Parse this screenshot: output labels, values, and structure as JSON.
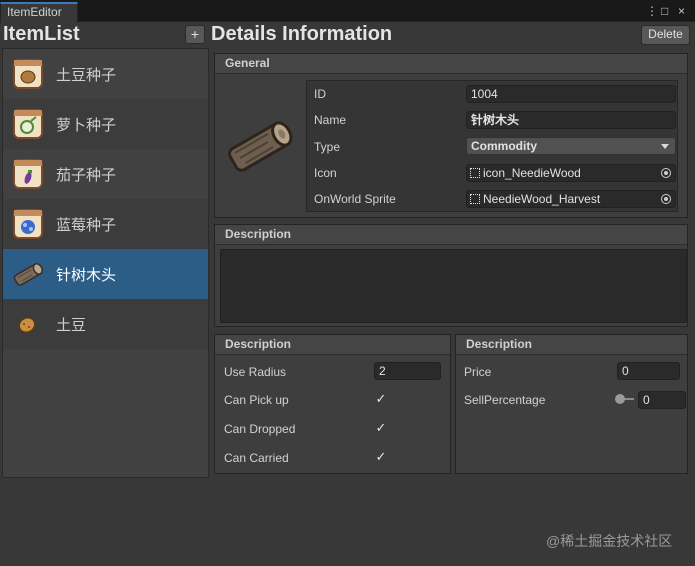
{
  "window": {
    "tab_title": "ItemEditor",
    "controls": [
      "⋮",
      "□",
      "×"
    ]
  },
  "item_list": {
    "title": "ItemList",
    "add_label": "+",
    "items": [
      {
        "label": "土豆种子",
        "icon": "potato-seed-icon"
      },
      {
        "label": "萝卜种子",
        "icon": "radish-seed-icon"
      },
      {
        "label": "茄子种子",
        "icon": "eggplant-seed-icon"
      },
      {
        "label": "蓝莓种子",
        "icon": "blueberry-seed-icon"
      },
      {
        "label": "针树木头",
        "icon": "log-icon",
        "selected": true
      },
      {
        "label": "土豆",
        "icon": "potato-icon"
      }
    ]
  },
  "details": {
    "title": "Details Information",
    "delete_label": "Delete",
    "general": {
      "header": "General",
      "preview_icon": "log-icon",
      "fields": {
        "id_label": "ID",
        "id_value": "1004",
        "name_label": "Name",
        "name_value": "针树木头",
        "type_label": "Type",
        "type_value": "Commodity",
        "icon_label": "Icon",
        "icon_value": "icon_NeedieWood",
        "sprite_label": "OnWorld Sprite",
        "sprite_value": "NeedieWood_Harvest"
      }
    },
    "description": {
      "header": "Description",
      "value": ""
    },
    "usage": {
      "header": "Description",
      "use_radius_label": "Use Radius",
      "use_radius_value": "2",
      "can_pick_up_label": "Can Pick up",
      "can_pick_up": true,
      "can_dropped_label": "Can Dropped",
      "can_dropped": true,
      "can_carried_label": "Can Carried",
      "can_carried": true
    },
    "price": {
      "header": "Description",
      "price_label": "Price",
      "price_value": "0",
      "sell_label": "SellPercentage",
      "sell_value": "0",
      "sell_slider_fraction": 0
    }
  },
  "watermark": "@稀土掘金技术社区",
  "check_glyph": "✓"
}
